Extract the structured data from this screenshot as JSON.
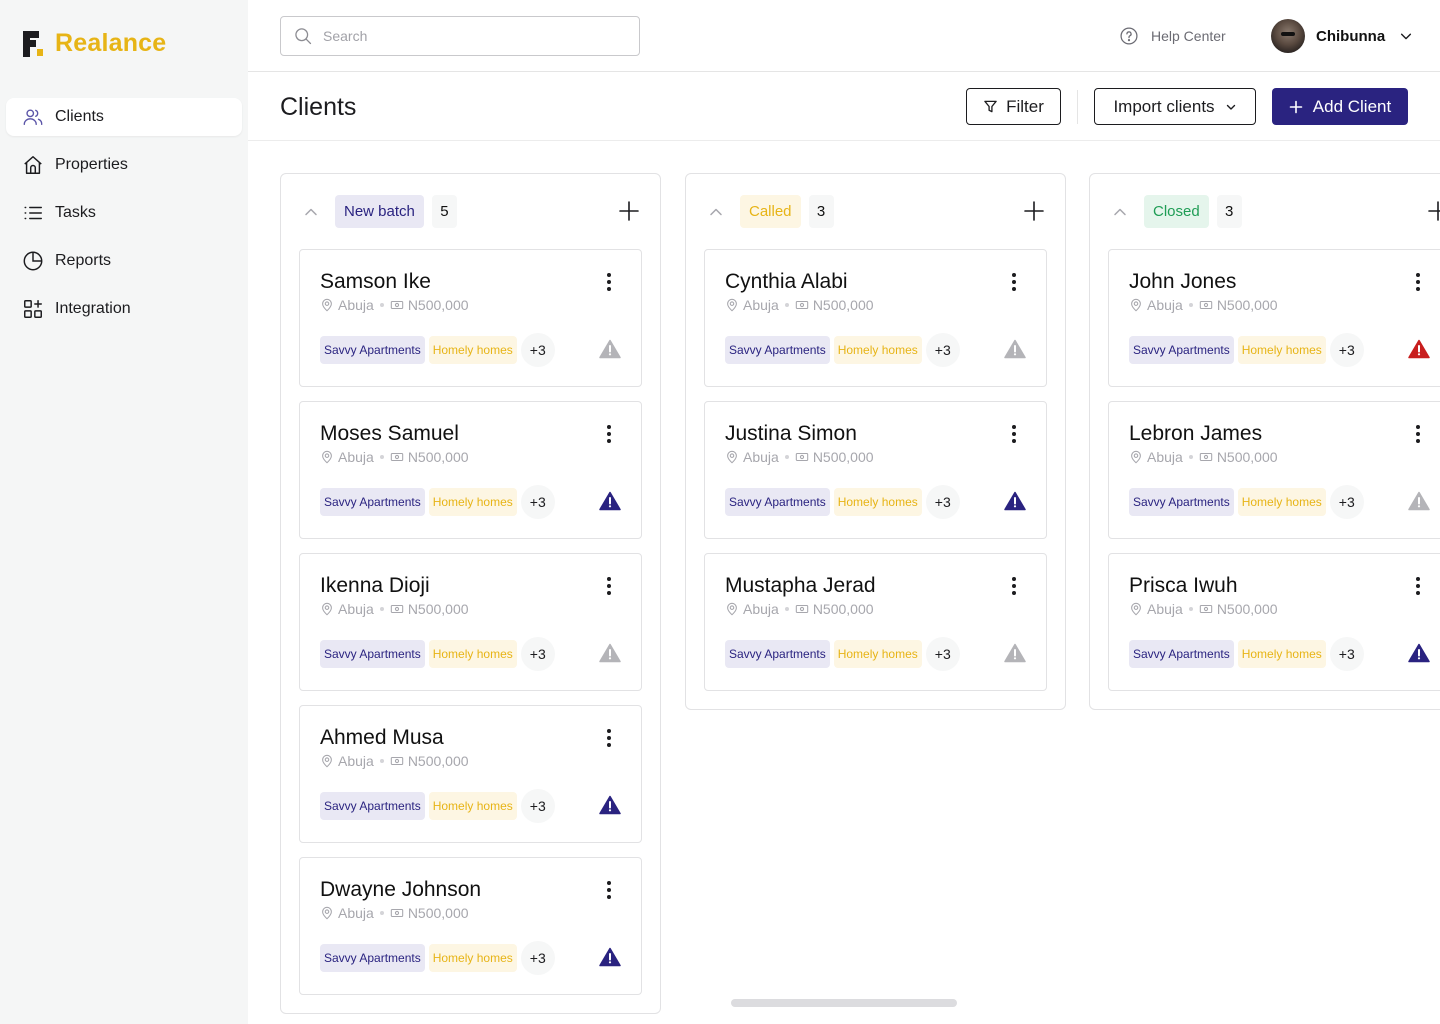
{
  "brand": {
    "name": "Realance"
  },
  "sidebar": {
    "items": [
      {
        "label": "Clients",
        "icon": "users-icon",
        "active": true
      },
      {
        "label": "Properties",
        "icon": "home-icon",
        "active": false
      },
      {
        "label": "Tasks",
        "icon": "list-icon",
        "active": false
      },
      {
        "label": "Reports",
        "icon": "pie-chart-icon",
        "active": false
      },
      {
        "label": "Integration",
        "icon": "grid-plus-icon",
        "active": false
      }
    ]
  },
  "topbar": {
    "search_placeholder": "Search",
    "search_value": "",
    "help_label": "Help Center",
    "user_name": "Chibunna"
  },
  "header": {
    "title": "Clients",
    "filter_label": "Filter",
    "import_label": "Import clients",
    "add_label": "Add Client"
  },
  "colors": {
    "brand": "#e7b416",
    "primary": "#2a2380",
    "warn_grey": "#b4b4b8",
    "warn_navy": "#2a2380",
    "warn_red": "#c81e1e"
  },
  "columns": [
    {
      "status": "New batch",
      "status_style": "new",
      "count": "5",
      "cards": [
        {
          "name": "Samson Ike",
          "location": "Abuja",
          "budget": "N500,000",
          "tags": [
            "Savvy Apartments",
            "Homely homes"
          ],
          "more": "+3",
          "alert": "grey"
        },
        {
          "name": "Moses Samuel",
          "location": "Abuja",
          "budget": "N500,000",
          "tags": [
            "Savvy Apartments",
            "Homely homes"
          ],
          "more": "+3",
          "alert": "navy"
        },
        {
          "name": "Ikenna Dioji",
          "location": "Abuja",
          "budget": "N500,000",
          "tags": [
            "Savvy Apartments",
            "Homely homes"
          ],
          "more": "+3",
          "alert": "grey"
        },
        {
          "name": "Ahmed Musa",
          "location": "Abuja",
          "budget": "N500,000",
          "tags": [
            "Savvy Apartments",
            "Homely homes"
          ],
          "more": "+3",
          "alert": "navy"
        },
        {
          "name": "Dwayne Johnson",
          "location": "Abuja",
          "budget": "N500,000",
          "tags": [
            "Savvy Apartments",
            "Homely homes"
          ],
          "more": "+3",
          "alert": "navy"
        }
      ]
    },
    {
      "status": "Called",
      "status_style": "called",
      "count": "3",
      "cards": [
        {
          "name": "Cynthia Alabi",
          "location": "Abuja",
          "budget": "N500,000",
          "tags": [
            "Savvy Apartments",
            "Homely homes"
          ],
          "more": "+3",
          "alert": "grey"
        },
        {
          "name": "Justina Simon",
          "location": "Abuja",
          "budget": "N500,000",
          "tags": [
            "Savvy Apartments",
            "Homely homes"
          ],
          "more": "+3",
          "alert": "navy"
        },
        {
          "name": "Mustapha Jerad",
          "location": "Abuja",
          "budget": "N500,000",
          "tags": [
            "Savvy Apartments",
            "Homely homes"
          ],
          "more": "+3",
          "alert": "grey"
        }
      ]
    },
    {
      "status": "Closed",
      "status_style": "closed",
      "count": "3",
      "cards": [
        {
          "name": "John Jones",
          "location": "Abuja",
          "budget": "N500,000",
          "tags": [
            "Savvy Apartments",
            "Homely homes"
          ],
          "more": "+3",
          "alert": "red"
        },
        {
          "name": "Lebron James",
          "location": "Abuja",
          "budget": "N500,000",
          "tags": [
            "Savvy Apartments",
            "Homely homes"
          ],
          "more": "+3",
          "alert": "grey"
        },
        {
          "name": "Prisca Iwuh",
          "location": "Abuja",
          "budget": "N500,000",
          "tags": [
            "Savvy Apartments",
            "Homely homes"
          ],
          "more": "+3",
          "alert": "navy"
        }
      ]
    }
  ]
}
